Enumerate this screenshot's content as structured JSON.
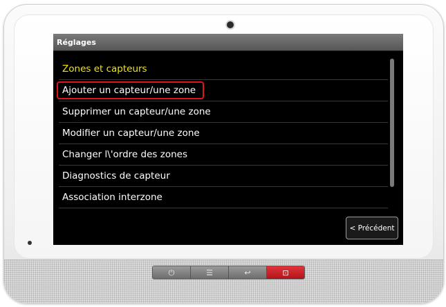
{
  "screen": {
    "title": "Réglages",
    "menu_items": [
      {
        "label": "Zones et capteurs",
        "kind": "header"
      },
      {
        "label": "Ajouter un capteur/une zone",
        "kind": "selected"
      },
      {
        "label": "Supprimer un capteur/une zone",
        "kind": "item"
      },
      {
        "label": "Modifier un capteur/une zone",
        "kind": "item"
      },
      {
        "label": "Changer l\\'ordre des zones",
        "kind": "item"
      },
      {
        "label": "Diagnostics de capteur",
        "kind": "item"
      },
      {
        "label": "Association interzone",
        "kind": "item"
      }
    ],
    "back_label": "< Précédent"
  },
  "hardware": {
    "buttons": [
      {
        "icon": "power-icon",
        "glyph": "⏻"
      },
      {
        "icon": "menu-icon",
        "glyph": "☰"
      },
      {
        "icon": "back-arrow-icon",
        "glyph": "↩"
      },
      {
        "icon": "alarm-icon",
        "glyph": "⊡"
      }
    ]
  },
  "colors": {
    "header_text": "#f2e600",
    "selection_outline": "#e0141a",
    "screen_bg": "#000000",
    "alarm_button": "#c8181e"
  }
}
